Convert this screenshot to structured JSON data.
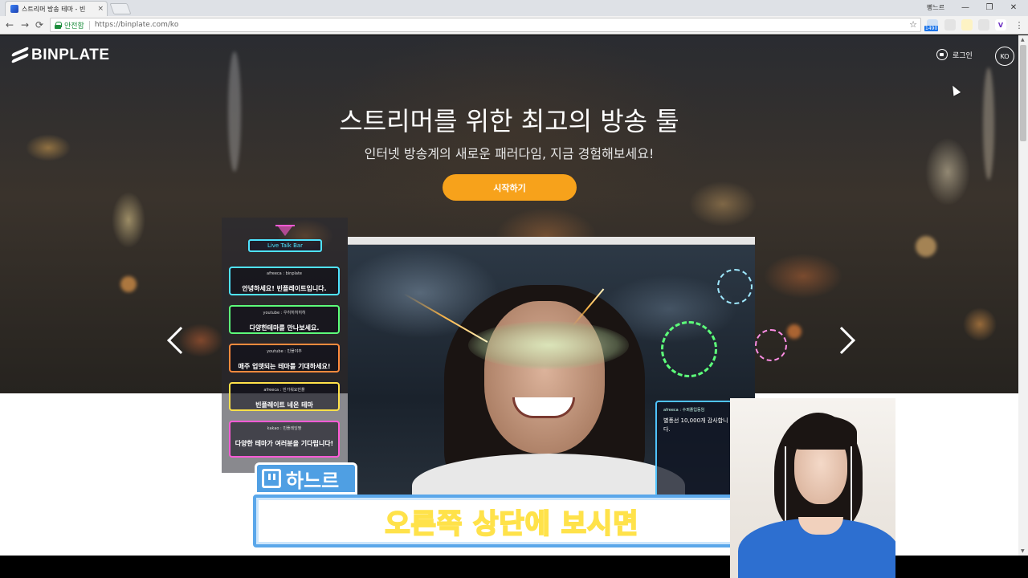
{
  "browser": {
    "tab_title": "스트리머 방송 테마 - 빈",
    "tab_close": "×",
    "profile_name": "빵느르",
    "window_controls": {
      "minimize": "—",
      "restore": "❐",
      "close": "✕"
    },
    "nav": {
      "back": "←",
      "forward": "→",
      "reload": "⟳"
    },
    "secure_label": "안전함",
    "url": "https://binplate.com/ko",
    "star": "☆",
    "extension_badge": "1490",
    "menu": "⋮"
  },
  "site": {
    "logo": "BINPLATE",
    "login": "로그인",
    "language": "KO",
    "hero_title": "스트리머를 위한 최고의 방송 툴",
    "hero_subtitle": "인터넷 방송계의 새로운 패러다임, 지금 경험해보세요!",
    "start_button": "시작하기"
  },
  "preview": {
    "live_talk_bar": "Live Talk Bar",
    "chats": [
      {
        "source": "afreeca : binplate",
        "message": "안녕하세요! 빈플레이트입니다.",
        "color": "#4fe3ff"
      },
      {
        "source": "youtube : 우히히히히히",
        "message": "다양한테마를 만나보세요.",
        "color": "#5dff7a"
      },
      {
        "source": "youtube : 빈플야추",
        "message": "매주 업뎃되는 테마를 기대하세요!",
        "color": "#ff8a3d"
      },
      {
        "source": "afreeca : 빈가워요빈플",
        "message": "빈플레이트 네온 테마",
        "color": "#ffe14a"
      },
      {
        "source": "kakao : 빈플레잉짱",
        "message": "다양한 테마가 여러분을 기다립니다!",
        "color": "#ff5bd6"
      }
    ],
    "side_card": {
      "source": "afreeca : 수퍼플입동임",
      "message": "별풍선 10,000개 감사합니다."
    }
  },
  "stream": {
    "streamer": "하느르",
    "caption": "오른쪽 상단에 보시면"
  }
}
